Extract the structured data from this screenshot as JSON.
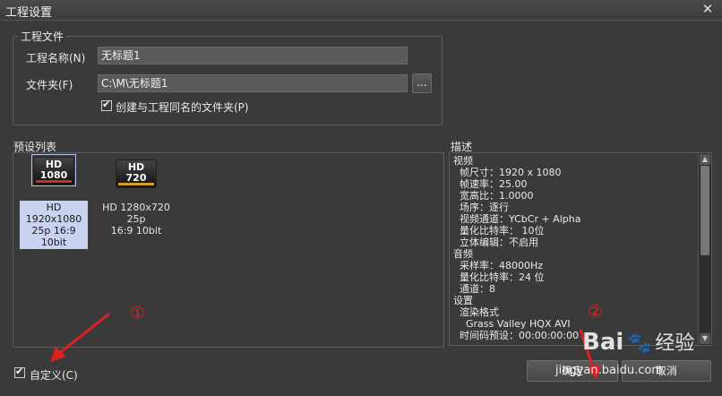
{
  "window": {
    "title": "工程设置",
    "close_glyph": "✕"
  },
  "project_file": {
    "group_label": "工程文件",
    "name_label": "工程名称(N)",
    "name_value": "无标题1",
    "folder_label": "文件夹(F)",
    "folder_value": "C:\\M\\无标题1",
    "browse_label": "...",
    "create_folder_label": "创建与工程同名的文件夹(P)",
    "create_folder_checked": true
  },
  "presets": {
    "section_label": "预设列表",
    "items": [
      {
        "badge_top": "HD",
        "badge_res": "1080",
        "caption_line1": "HD 1920x1080",
        "caption_line2": "25p 16:9 10bit",
        "selected": true,
        "accent": "#c8302a"
      },
      {
        "badge_top": "HD",
        "badge_res": "720",
        "caption_line1": "HD 1280x720 25p",
        "caption_line2": "16:9 10bit",
        "selected": false,
        "accent": "#d4a020"
      }
    ]
  },
  "description": {
    "section_label": "描述",
    "lines": [
      "视频",
      "  帧尺寸：1920 x 1080",
      "  帧速率：25.00",
      "  宽高比：1.0000",
      "  场序：逐行",
      "  视频通道：YCbCr + Alpha",
      "  量化比特率： 10位",
      "  立体编辑：不启用",
      "音频",
      "  采样率：48000Hz",
      "  量化比特率：24 位",
      "  通道：8",
      "设置",
      "  渲染格式",
      "    Grass Valley HQX AVI",
      "  时间码预设：00:00:00:00"
    ]
  },
  "footer": {
    "custom_label": "自定义(C)",
    "custom_checked": true,
    "ok_label": "确定",
    "cancel_label": "取消"
  },
  "annotations": {
    "marker1": "①",
    "marker2": "②",
    "color": "#e02020"
  },
  "watermark": {
    "brand": "Bai",
    "brand2": "经验",
    "url": "jingyan.baidu.com"
  }
}
